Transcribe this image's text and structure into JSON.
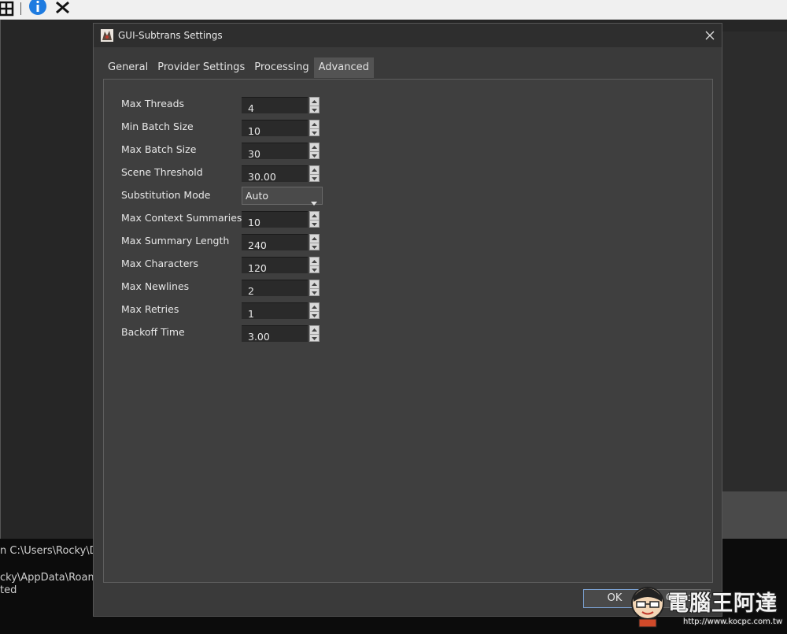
{
  "dialog": {
    "title": "GUI-Subtrans Settings",
    "tabs": [
      {
        "label": "General",
        "active": false
      },
      {
        "label": "Provider Settings",
        "active": false
      },
      {
        "label": "Processing",
        "active": false
      },
      {
        "label": "Advanced",
        "active": true
      }
    ],
    "settings": [
      {
        "label": "Max Threads",
        "value": "4",
        "type": "spinbox"
      },
      {
        "label": "Min Batch Size",
        "value": "10",
        "type": "spinbox"
      },
      {
        "label": "Max Batch Size",
        "value": "30",
        "type": "spinbox"
      },
      {
        "label": "Scene Threshold",
        "value": "30.00",
        "type": "spinbox"
      },
      {
        "label": "Substitution Mode",
        "value": "Auto",
        "type": "dropdown"
      },
      {
        "label": "Max Context Summaries",
        "value": "10",
        "type": "spinbox"
      },
      {
        "label": "Max Summary Length",
        "value": "240",
        "type": "spinbox"
      },
      {
        "label": "Max Characters",
        "value": "120",
        "type": "spinbox"
      },
      {
        "label": "Max Newlines",
        "value": "2",
        "type": "spinbox"
      },
      {
        "label": "Max Retries",
        "value": "1",
        "type": "spinbox"
      },
      {
        "label": "Backoff Time",
        "value": "3.00",
        "type": "spinbox"
      }
    ],
    "ok_label": "OK",
    "cancel_label": "Cancel"
  },
  "console": {
    "lines": [
      "n C:\\Users\\Rocky\\Do",
      "cky\\AppData\\Roami",
      "ted"
    ]
  },
  "watermark": {
    "title": "電腦王阿達",
    "url": "http://www.kocpc.com.tw"
  },
  "colors": {
    "dialog_bg": "#3a3a3a",
    "titlebar_bg": "#2e2e2e",
    "field_bg": "#2a2a2a",
    "active_tab": "#535353",
    "ok_border": "#7aa0d0",
    "toolbar_info_blue": "#1e7be0"
  },
  "icons": {
    "toolbar": [
      "grid-icon",
      "info-icon",
      "tools-icon"
    ],
    "dialog": [
      "app-logo-icon",
      "close-icon",
      "chevron-down-icon",
      "spin-up-icon",
      "spin-down-icon"
    ]
  }
}
